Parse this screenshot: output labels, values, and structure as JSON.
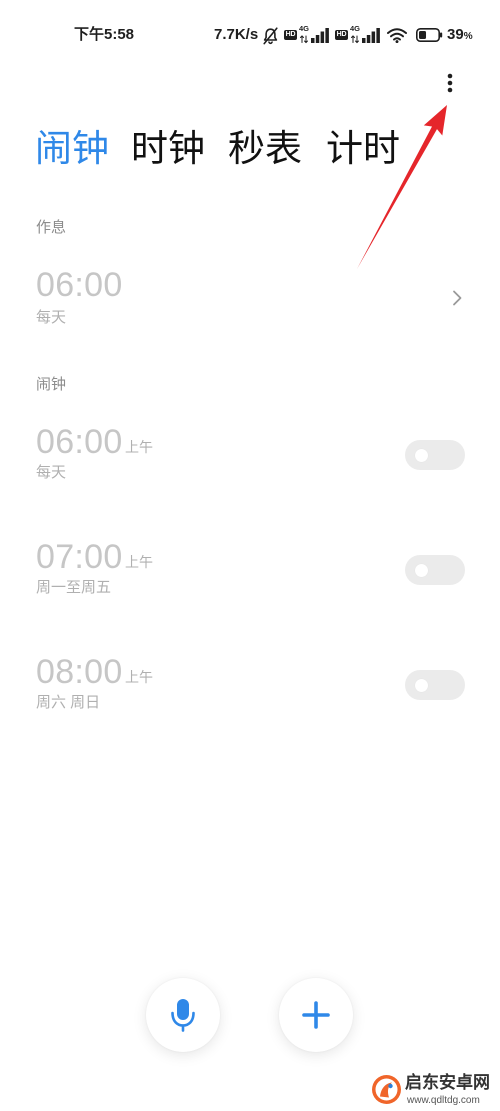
{
  "status_bar": {
    "time": "下午5:58",
    "net_speed": "7.7K/s",
    "sim1": {
      "hd": "HD",
      "network": "4G"
    },
    "sim2": {
      "hd": "HD",
      "network": "4G"
    },
    "battery_value": "39",
    "battery_unit": "%",
    "battery_level": 0.39
  },
  "icons": {
    "mute": "mute-bell-icon",
    "signal": "cellular-signal-icon",
    "wifi": "wifi-icon",
    "battery": "battery-icon",
    "menu": "more-vertical-icon",
    "chevron": "chevron-right-icon",
    "voice": "microphone-icon",
    "add": "plus-icon"
  },
  "tabs": [
    {
      "label": "闹钟",
      "active": true
    },
    {
      "label": "时钟",
      "active": false
    },
    {
      "label": "秒表",
      "active": false
    },
    {
      "label": "计时",
      "active": false
    }
  ],
  "schedule": {
    "section_title": "作息",
    "item": {
      "time": "06:00",
      "repeat": "每天"
    }
  },
  "alarms": {
    "section_title": "闹钟",
    "items": [
      {
        "time": "06:00",
        "period": "上午",
        "repeat": "每天",
        "enabled": false
      },
      {
        "time": "07:00",
        "period": "上午",
        "repeat": "周一至周五",
        "enabled": false
      },
      {
        "time": "08:00",
        "period": "上午",
        "repeat": "周六 周日",
        "enabled": false
      }
    ]
  },
  "watermark": {
    "name": "启东安卓网",
    "url": "www.qdltdg.com"
  },
  "colors": {
    "accent": "#2f88e8",
    "annotation": "#e5262b",
    "time_text": "#c6c6c6",
    "secondary_text": "#b0b0b0",
    "section_text": "#8c8c8c",
    "toggle_off": "#ebebeb",
    "status_ink": "#1f1f1f",
    "tab_ink": "#111111"
  }
}
